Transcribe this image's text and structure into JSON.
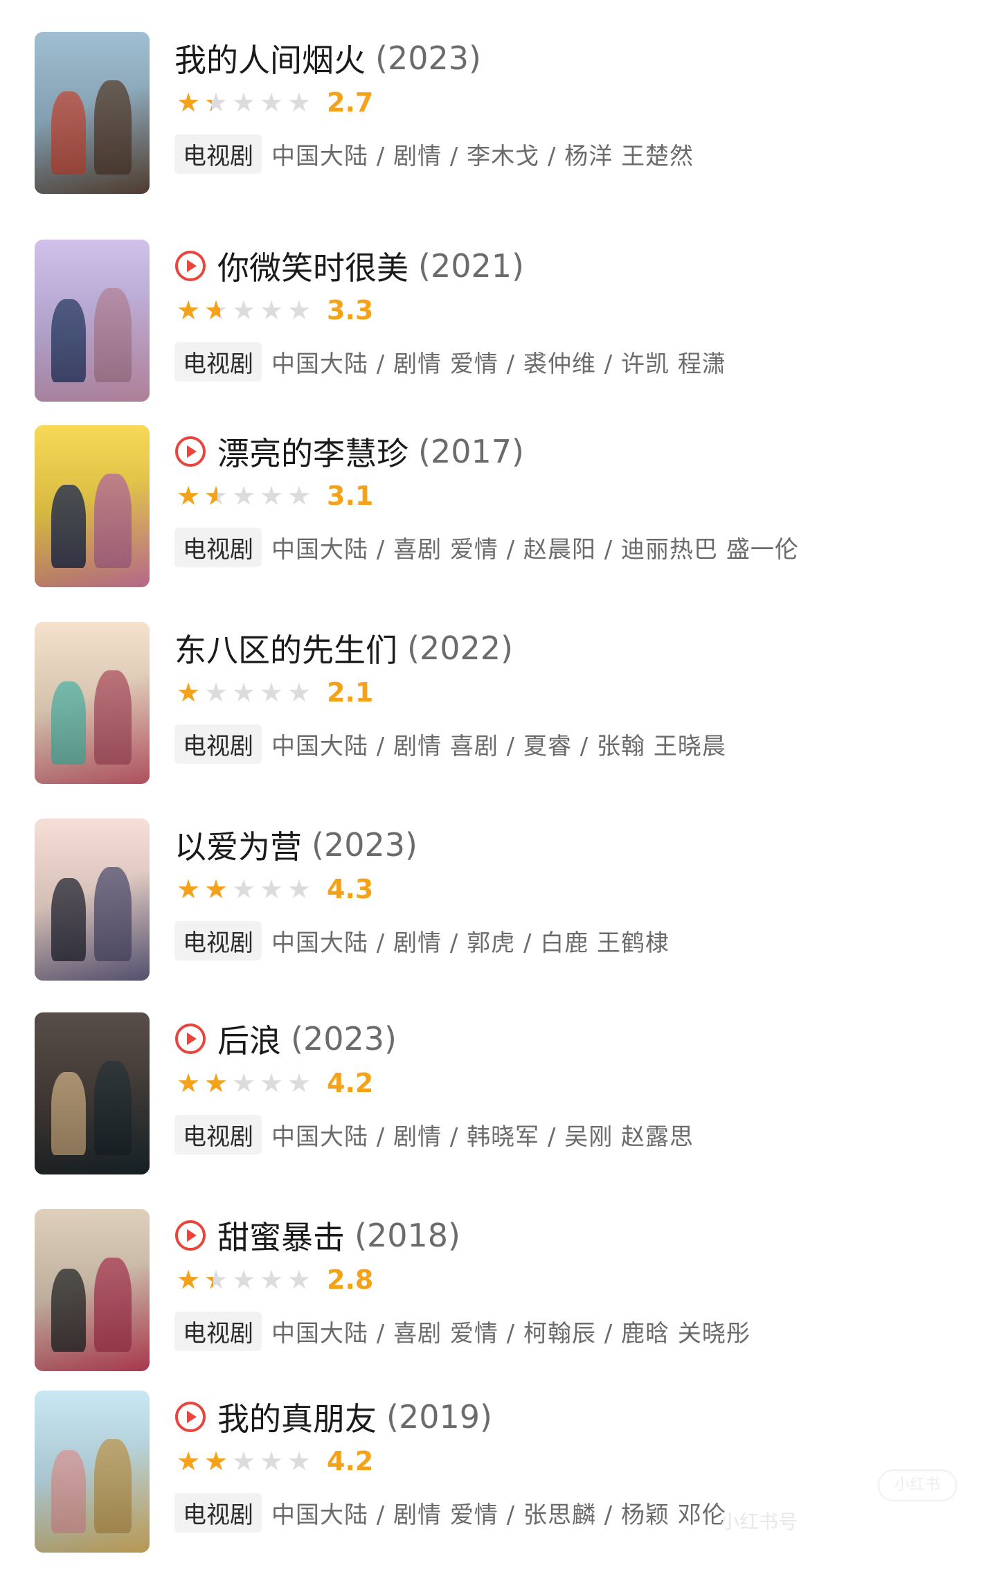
{
  "items": [
    {
      "title": "我的人间烟火",
      "year": "(2023)",
      "has_play": false,
      "score_text": "2.7",
      "rating_fraction": 0.27,
      "type": "电视剧",
      "meta": "中国大陆 / 剧情 / 李木戈 / 杨洋 王楚然",
      "poster": {
        "bg": "#8fb3c9",
        "bg2": "#6a4f3d",
        "accent": "#c84b3b"
      }
    },
    {
      "title": "你微笑时很美",
      "year": "(2021)",
      "has_play": true,
      "score_text": "3.3",
      "rating_fraction": 0.33,
      "type": "电视剧",
      "meta": "中国大陆 / 剧情 爱情 / 裘仲维 / 许凯 程潇",
      "poster": {
        "bg": "#c8b6e8",
        "bg2": "#e9a9c9",
        "accent": "#2e3f6e"
      }
    },
    {
      "title": "漂亮的李慧珍",
      "year": "(2017)",
      "has_play": true,
      "score_text": "3.1",
      "rating_fraction": 0.31,
      "type": "电视剧",
      "meta": "中国大陆 / 喜剧 爱情 / 赵晨阳 / 迪丽热巴 盛一伦",
      "poster": {
        "bg": "#f6d23a",
        "bg2": "#f08ab8",
        "accent": "#1d2a4a"
      }
    },
    {
      "title": "东八区的先生们",
      "year": "(2022)",
      "has_play": false,
      "score_text": "2.1",
      "rating_fraction": 0.21,
      "type": "电视剧",
      "meta": "中国大陆 / 剧情 喜剧 / 夏睿 / 张翰 王晓晨",
      "poster": {
        "bg": "#f3ddc3",
        "bg2": "#e86b7f",
        "accent": "#5cc2b0"
      }
    },
    {
      "title": "以爱为营",
      "year": "(2023)",
      "has_play": false,
      "score_text": "4.3",
      "rating_fraction": 0.43,
      "type": "电视剧",
      "meta": "中国大陆 / 剧情 / 郭虎 / 白鹿 王鹤棣",
      "poster": {
        "bg": "#f4d9cf",
        "bg2": "#6f6a93",
        "accent": "#2b2b3a"
      }
    },
    {
      "title": "后浪",
      "year": "(2023)",
      "has_play": true,
      "score_text": "4.2",
      "rating_fraction": 0.42,
      "type": "电视剧",
      "meta": "中国大陆 / 剧情 / 韩晓军 / 吴刚 赵露思",
      "poster": {
        "bg": "#3a2f2a",
        "bg2": "#1c2a30",
        "accent": "#c9a77a"
      }
    },
    {
      "title": "甜蜜暴击",
      "year": "(2018)",
      "has_play": true,
      "score_text": "2.8",
      "rating_fraction": 0.28,
      "type": "电视剧",
      "meta": "中国大陆 / 喜剧 爱情 / 柯翰辰 / 鹿晗 关晓彤",
      "poster": {
        "bg": "#d9c7b0",
        "bg2": "#e04a68",
        "accent": "#2a2a2a"
      }
    },
    {
      "title": "我的真朋友",
      "year": "(2019)",
      "has_play": true,
      "score_text": "4.2",
      "rating_fraction": 0.42,
      "type": "电视剧",
      "meta": "中国大陆 / 剧情 爱情 / 张思麟 / 杨颖 邓伦",
      "poster": {
        "bg": "#bfe3f0",
        "bg2": "#f6c96b",
        "accent": "#e6a2a0"
      }
    }
  ],
  "colors": {
    "star": "#f5a21b",
    "play": "#e8453c"
  },
  "watermark": {
    "text": "小红书号",
    "badge": "小红书"
  }
}
